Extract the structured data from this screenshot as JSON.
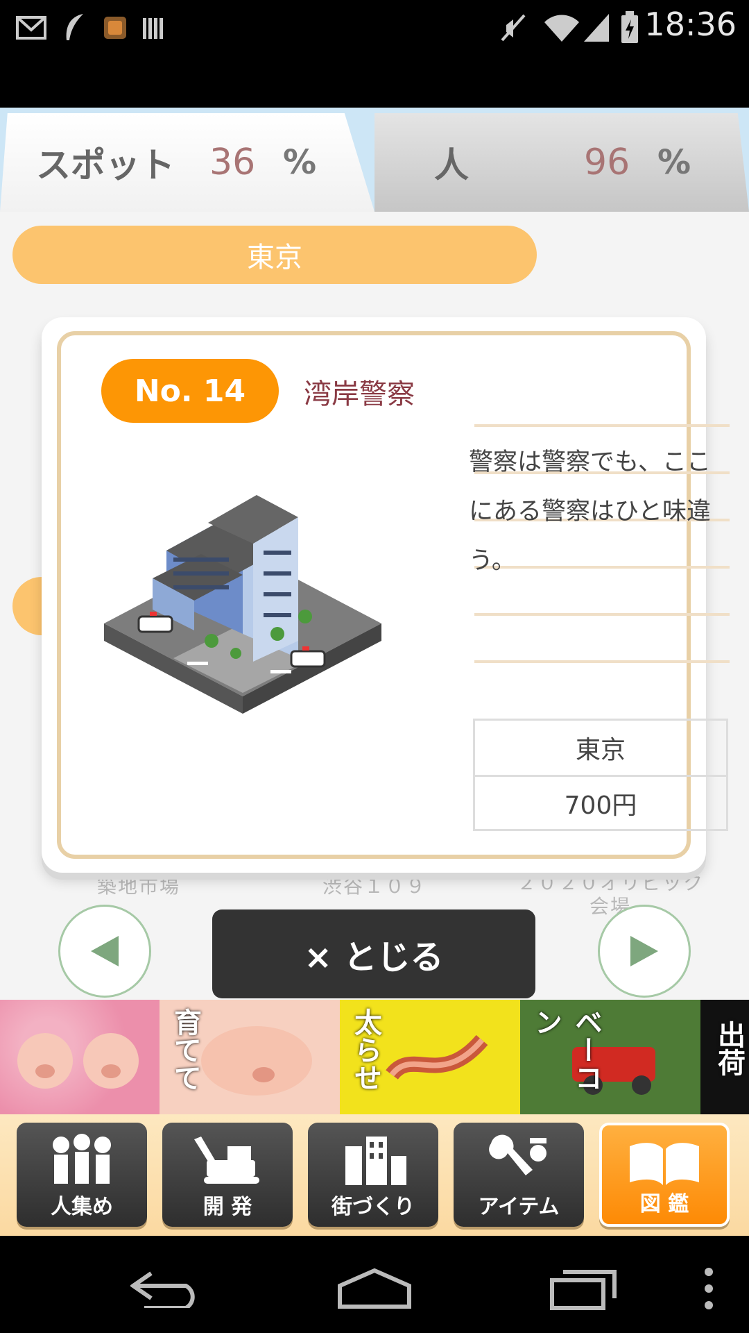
{
  "status_bar": {
    "time": "18:36",
    "icons": [
      "gmail-icon",
      "feather-icon",
      "game-app-icon",
      "barcode-icon",
      "mute-icon",
      "wifi-icon",
      "signal-icon",
      "battery-charging-icon"
    ]
  },
  "tabs": [
    {
      "label": "スポット",
      "percent": "36",
      "symbol": "%"
    },
    {
      "label": "人",
      "percent": "96",
      "symbol": "%"
    }
  ],
  "region": "東京",
  "card": {
    "number": "No. 14",
    "name": "湾岸警察",
    "description": "警察は警察でも、ここにある警察はひと味違う。",
    "table": {
      "region": "東京",
      "price": "700円"
    }
  },
  "behind_labels": [
    "築地市場",
    "渋谷１０９",
    "２０２０オリピック会場"
  ],
  "close_label": "× とじる",
  "ad": {
    "words": [
      "育てて",
      "太らせ",
      "ベーコン",
      "出荷"
    ]
  },
  "bottom_nav": [
    {
      "label": "人集め",
      "icon": "people-icon"
    },
    {
      "label": "開 発",
      "icon": "excavator-icon"
    },
    {
      "label": "街づくり",
      "icon": "buildings-icon"
    },
    {
      "label": "アイテム",
      "icon": "wrench-icon"
    },
    {
      "label": "図 鑑",
      "icon": "book-icon"
    }
  ],
  "colors": {
    "accent": "#fd9605",
    "pill": "#fcc46e",
    "name": "#8a3a44"
  }
}
